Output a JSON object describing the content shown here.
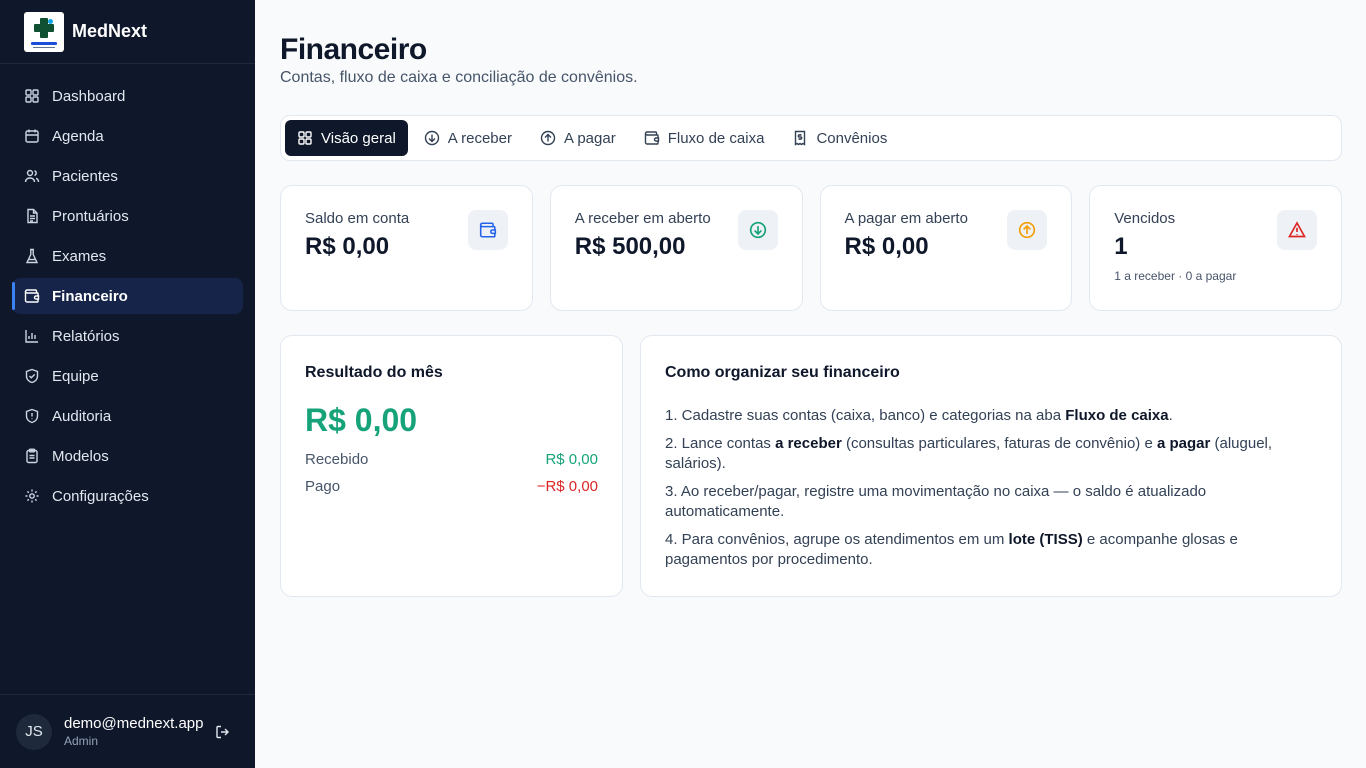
{
  "app": {
    "name": "MedNext"
  },
  "sidebar": {
    "items": [
      {
        "label": "Dashboard",
        "icon": "dashboard-icon"
      },
      {
        "label": "Agenda",
        "icon": "calendar-icon"
      },
      {
        "label": "Pacientes",
        "icon": "users-icon"
      },
      {
        "label": "Prontuários",
        "icon": "file-text-icon"
      },
      {
        "label": "Exames",
        "icon": "flask-icon"
      },
      {
        "label": "Financeiro",
        "icon": "wallet-icon",
        "active": true
      },
      {
        "label": "Relatórios",
        "icon": "bar-chart-icon"
      },
      {
        "label": "Equipe",
        "icon": "shield-check-icon"
      },
      {
        "label": "Auditoria",
        "icon": "shield-alert-icon"
      },
      {
        "label": "Modelos",
        "icon": "clipboard-icon"
      },
      {
        "label": "Configurações",
        "icon": "gear-icon"
      }
    ]
  },
  "user": {
    "initials": "JS",
    "email": "demo@mednext.app",
    "role": "Admin"
  },
  "header": {
    "title": "Financeiro",
    "subtitle": "Contas, fluxo de caixa e conciliação de convênios."
  },
  "tabs": [
    {
      "label": "Visão geral",
      "icon": "grid-icon",
      "active": true
    },
    {
      "label": "A receber",
      "icon": "arrow-down-circle-icon"
    },
    {
      "label": "A pagar",
      "icon": "arrow-up-circle-icon"
    },
    {
      "label": "Fluxo de caixa",
      "icon": "wallet-icon"
    },
    {
      "label": "Convênios",
      "icon": "receipt-icon"
    }
  ],
  "stats": [
    {
      "label": "Saldo em conta",
      "value": "R$ 0,00",
      "icon": "wallet-icon",
      "icon_color": "#2563eb"
    },
    {
      "label": "A receber em aberto",
      "value": "R$ 500,00",
      "icon": "arrow-down-circle-icon",
      "icon_color": "#16a37a"
    },
    {
      "label": "A pagar em aberto",
      "value": "R$ 0,00",
      "icon": "arrow-up-circle-icon",
      "icon_color": "#f59e0b"
    },
    {
      "label": "Vencidos",
      "value": "1",
      "note": "1 a receber · 0 a pagar",
      "icon": "alert-triangle-icon",
      "icon_color": "#dc2626"
    }
  ],
  "result": {
    "title": "Resultado do mês",
    "value": "R$ 0,00",
    "received_label": "Recebido",
    "received_value": "R$ 0,00",
    "paid_label": "Pago",
    "paid_value": "−R$ 0,00"
  },
  "guide": {
    "title": "Como organizar seu financeiro",
    "steps": [
      {
        "pre": "1. Cadastre suas contas (caixa, banco) e categorias na aba ",
        "b1": "Fluxo de caixa",
        "mid": ".",
        "b2": "",
        "post": ""
      },
      {
        "pre": "2. Lance contas ",
        "b1": "a receber",
        "mid": " (consultas particulares, faturas de convênio) e ",
        "b2": "a pagar",
        "post": " (aluguel, salários)."
      },
      {
        "pre": "3. Ao receber/pagar, registre uma movimentação no caixa — o saldo é atualizado automaticamente.",
        "b1": "",
        "mid": "",
        "b2": "",
        "post": ""
      },
      {
        "pre": "4. Para convênios, agrupe os atendimentos em um ",
        "b1": "lote (TISS)",
        "mid": " e acompanhe glosas e pagamentos por procedimento.",
        "b2": "",
        "post": ""
      }
    ]
  }
}
